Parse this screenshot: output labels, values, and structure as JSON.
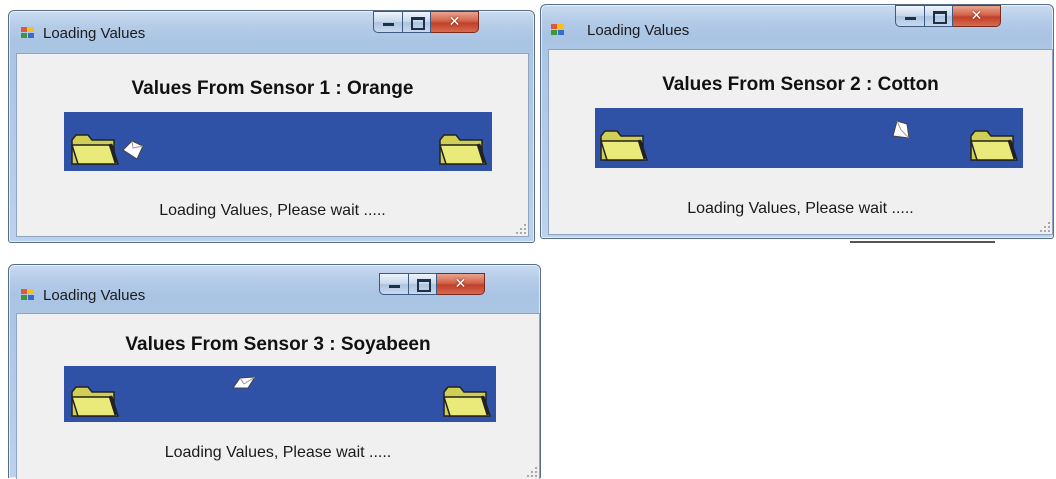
{
  "windows": [
    {
      "title": "Loading Values",
      "heading": "Values From Sensor 1 : Orange",
      "status": "Loading Values, Please wait .....",
      "caption": {
        "minimize": "minimize",
        "maximize": "maximize",
        "close": "close"
      }
    },
    {
      "title": "Loading Values",
      "heading": "Values From Sensor 2 : Cotton",
      "status": "Loading Values, Please wait .....",
      "caption": {
        "minimize": "minimize",
        "maximize": "maximize",
        "close": "close"
      }
    },
    {
      "title": "Loading Values",
      "heading": "Values From Sensor 3 : Soyabeen",
      "status": "Loading Values, Please wait .....",
      "caption": {
        "minimize": "minimize",
        "maximize": "maximize",
        "close": "close"
      }
    }
  ],
  "icons": {
    "app": "app-form-icon",
    "folder": "folder-icon",
    "paper": "flying-document-icon",
    "close_glyph": "✕"
  },
  "colors": {
    "animation_background": "#2f52a7",
    "folder_fill": "#e8e878",
    "client_background": "#f0f0f0"
  }
}
